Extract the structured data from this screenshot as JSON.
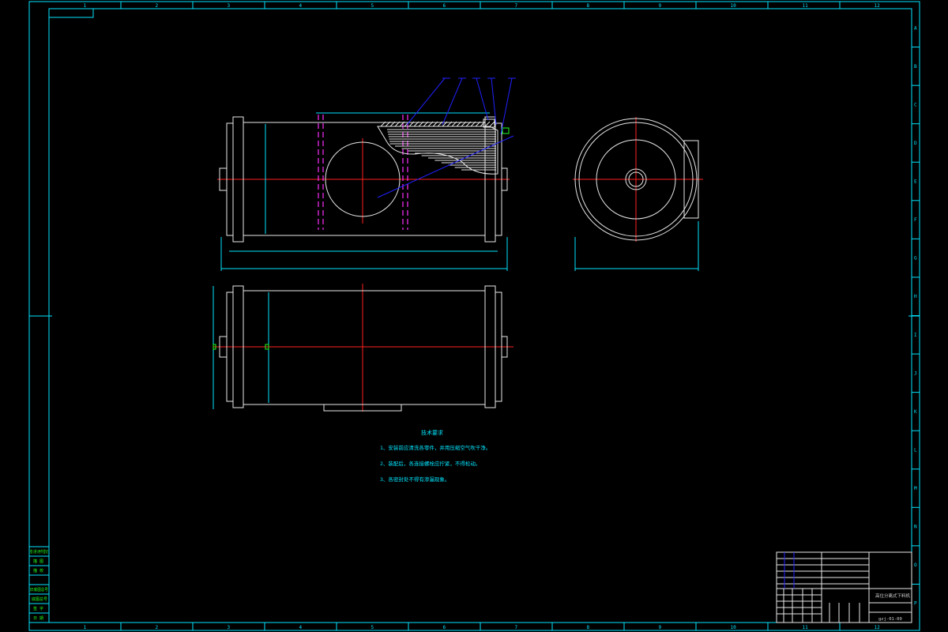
{
  "frame": {
    "columns": [
      "1",
      "2",
      "3",
      "4",
      "5",
      "6",
      "7",
      "8",
      "9",
      "10",
      "11",
      "12"
    ],
    "rows": [
      "A",
      "B",
      "C",
      "D",
      "E",
      "F",
      "G",
      "H",
      "I",
      "J",
      "K",
      "L",
      "M",
      "N",
      "O",
      "P"
    ]
  },
  "notes": {
    "title": "技术要求",
    "items": [
      "1、安装前应清洗各零件，并用压缩空气吹干净。",
      "2、装配后，各连接螺栓应拧紧，不得松动。",
      "3、各密封处不得有渗漏现象。"
    ]
  },
  "title_block": {
    "drawing_name": "高位分离式下料机",
    "drawing_no": "gzj-01-00",
    "scale_label": "比例",
    "sheet_label": "共 张 第 张"
  },
  "side_block": {
    "labels": [
      "借(通)用件登记",
      "描 图",
      "描 校",
      "旧底图总号",
      "底图总号",
      "签 字",
      "日 期"
    ]
  },
  "colors": {
    "frame": "#00e5ff",
    "object": "#e8e8e8",
    "centerline": "#ff2020",
    "hidden": "#ff30ff",
    "leader": "#2020ff"
  }
}
